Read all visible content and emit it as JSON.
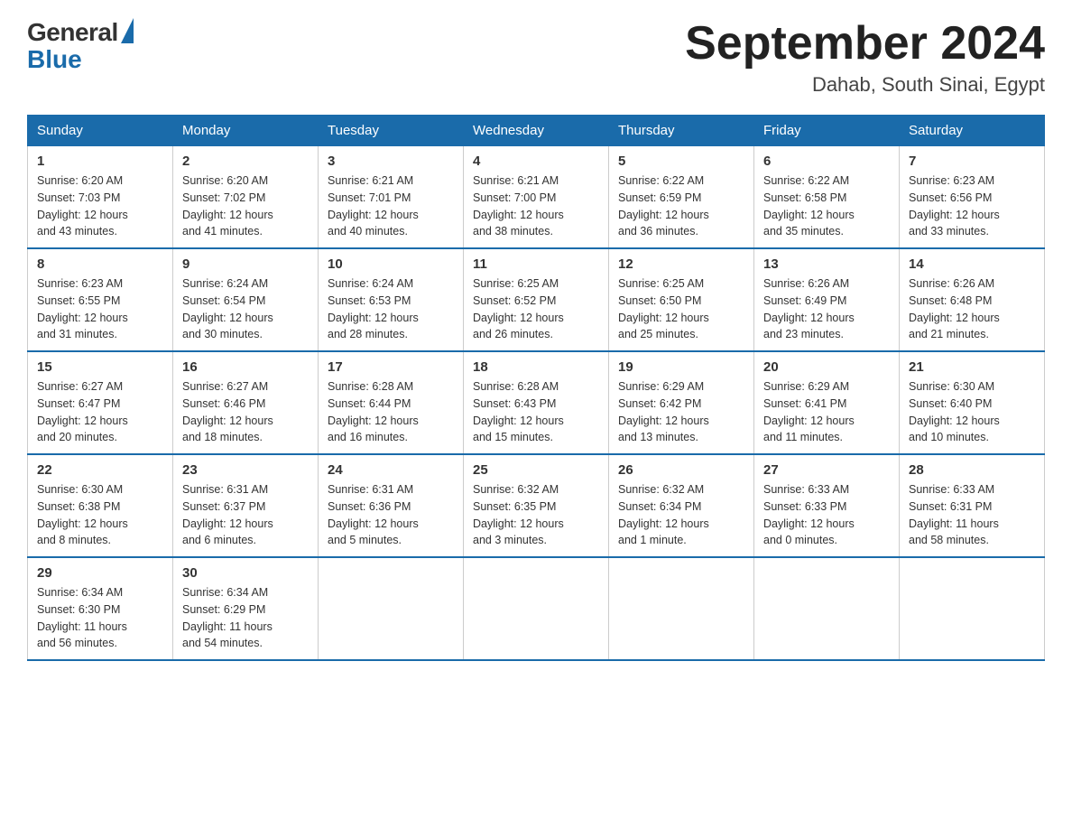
{
  "logo": {
    "general": "General",
    "blue": "Blue"
  },
  "title": "September 2024",
  "location": "Dahab, South Sinai, Egypt",
  "headers": [
    "Sunday",
    "Monday",
    "Tuesday",
    "Wednesday",
    "Thursday",
    "Friday",
    "Saturday"
  ],
  "weeks": [
    [
      {
        "day": "1",
        "sunrise": "6:20 AM",
        "sunset": "7:03 PM",
        "daylight": "12 hours and 43 minutes."
      },
      {
        "day": "2",
        "sunrise": "6:20 AM",
        "sunset": "7:02 PM",
        "daylight": "12 hours and 41 minutes."
      },
      {
        "day": "3",
        "sunrise": "6:21 AM",
        "sunset": "7:01 PM",
        "daylight": "12 hours and 40 minutes."
      },
      {
        "day": "4",
        "sunrise": "6:21 AM",
        "sunset": "7:00 PM",
        "daylight": "12 hours and 38 minutes."
      },
      {
        "day": "5",
        "sunrise": "6:22 AM",
        "sunset": "6:59 PM",
        "daylight": "12 hours and 36 minutes."
      },
      {
        "day": "6",
        "sunrise": "6:22 AM",
        "sunset": "6:58 PM",
        "daylight": "12 hours and 35 minutes."
      },
      {
        "day": "7",
        "sunrise": "6:23 AM",
        "sunset": "6:56 PM",
        "daylight": "12 hours and 33 minutes."
      }
    ],
    [
      {
        "day": "8",
        "sunrise": "6:23 AM",
        "sunset": "6:55 PM",
        "daylight": "12 hours and 31 minutes."
      },
      {
        "day": "9",
        "sunrise": "6:24 AM",
        "sunset": "6:54 PM",
        "daylight": "12 hours and 30 minutes."
      },
      {
        "day": "10",
        "sunrise": "6:24 AM",
        "sunset": "6:53 PM",
        "daylight": "12 hours and 28 minutes."
      },
      {
        "day": "11",
        "sunrise": "6:25 AM",
        "sunset": "6:52 PM",
        "daylight": "12 hours and 26 minutes."
      },
      {
        "day": "12",
        "sunrise": "6:25 AM",
        "sunset": "6:50 PM",
        "daylight": "12 hours and 25 minutes."
      },
      {
        "day": "13",
        "sunrise": "6:26 AM",
        "sunset": "6:49 PM",
        "daylight": "12 hours and 23 minutes."
      },
      {
        "day": "14",
        "sunrise": "6:26 AM",
        "sunset": "6:48 PM",
        "daylight": "12 hours and 21 minutes."
      }
    ],
    [
      {
        "day": "15",
        "sunrise": "6:27 AM",
        "sunset": "6:47 PM",
        "daylight": "12 hours and 20 minutes."
      },
      {
        "day": "16",
        "sunrise": "6:27 AM",
        "sunset": "6:46 PM",
        "daylight": "12 hours and 18 minutes."
      },
      {
        "day": "17",
        "sunrise": "6:28 AM",
        "sunset": "6:44 PM",
        "daylight": "12 hours and 16 minutes."
      },
      {
        "day": "18",
        "sunrise": "6:28 AM",
        "sunset": "6:43 PM",
        "daylight": "12 hours and 15 minutes."
      },
      {
        "day": "19",
        "sunrise": "6:29 AM",
        "sunset": "6:42 PM",
        "daylight": "12 hours and 13 minutes."
      },
      {
        "day": "20",
        "sunrise": "6:29 AM",
        "sunset": "6:41 PM",
        "daylight": "12 hours and 11 minutes."
      },
      {
        "day": "21",
        "sunrise": "6:30 AM",
        "sunset": "6:40 PM",
        "daylight": "12 hours and 10 minutes."
      }
    ],
    [
      {
        "day": "22",
        "sunrise": "6:30 AM",
        "sunset": "6:38 PM",
        "daylight": "12 hours and 8 minutes."
      },
      {
        "day": "23",
        "sunrise": "6:31 AM",
        "sunset": "6:37 PM",
        "daylight": "12 hours and 6 minutes."
      },
      {
        "day": "24",
        "sunrise": "6:31 AM",
        "sunset": "6:36 PM",
        "daylight": "12 hours and 5 minutes."
      },
      {
        "day": "25",
        "sunrise": "6:32 AM",
        "sunset": "6:35 PM",
        "daylight": "12 hours and 3 minutes."
      },
      {
        "day": "26",
        "sunrise": "6:32 AM",
        "sunset": "6:34 PM",
        "daylight": "12 hours and 1 minute."
      },
      {
        "day": "27",
        "sunrise": "6:33 AM",
        "sunset": "6:33 PM",
        "daylight": "12 hours and 0 minutes."
      },
      {
        "day": "28",
        "sunrise": "6:33 AM",
        "sunset": "6:31 PM",
        "daylight": "11 hours and 58 minutes."
      }
    ],
    [
      {
        "day": "29",
        "sunrise": "6:34 AM",
        "sunset": "6:30 PM",
        "daylight": "11 hours and 56 minutes."
      },
      {
        "day": "30",
        "sunrise": "6:34 AM",
        "sunset": "6:29 PM",
        "daylight": "11 hours and 54 minutes."
      },
      null,
      null,
      null,
      null,
      null
    ]
  ],
  "labels": {
    "sunrise": "Sunrise:",
    "sunset": "Sunset:",
    "daylight": "Daylight:"
  }
}
